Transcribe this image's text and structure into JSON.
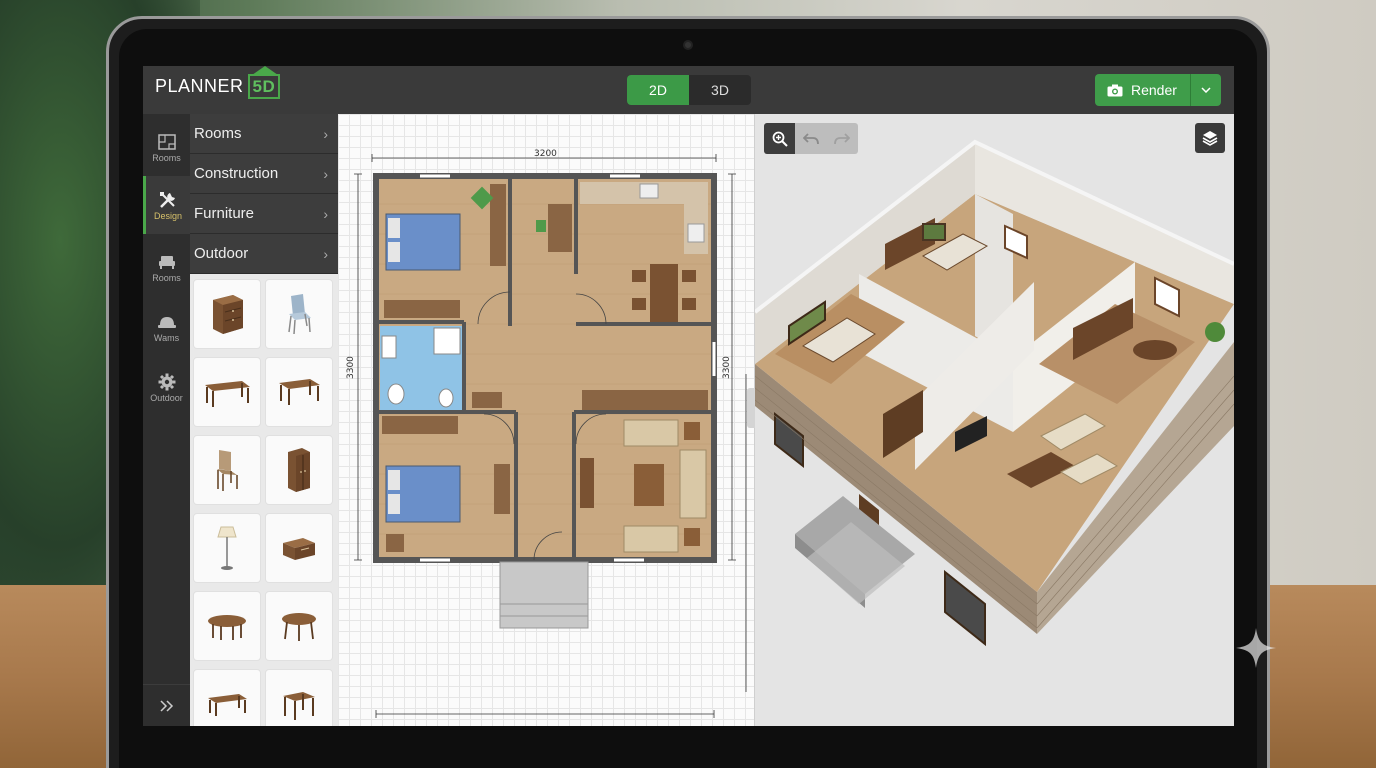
{
  "app": {
    "logo_text": "PLANNER",
    "logo_badge": "5D"
  },
  "header": {
    "mode_2d": "2D",
    "mode_3d": "3D",
    "active_mode": "2D",
    "render_label": "Render"
  },
  "rail": {
    "items": [
      {
        "label": "Rooms",
        "icon": "floorplan-icon"
      },
      {
        "label": "Design",
        "icon": "tools-icon",
        "active": true
      },
      {
        "label": "Rooms",
        "icon": "sofa-icon"
      },
      {
        "label": "Wams",
        "icon": "cap-icon"
      },
      {
        "label": "Outdoor",
        "icon": "gear-icon"
      }
    ]
  },
  "categories": [
    {
      "label": "Rooms"
    },
    {
      "label": "Construction"
    },
    {
      "label": "Furniture"
    },
    {
      "label": "Outdoor"
    }
  ],
  "catalog": [
    "nightstand-icon",
    "chair-icon",
    "coffee-table-icon",
    "bench-table-icon",
    "dining-chair-icon",
    "wardrobe-icon",
    "floor-lamp-icon",
    "chest-icon",
    "oval-table-icon",
    "round-table-icon",
    "low-table-icon",
    "square-table-icon"
  ],
  "plan": {
    "width_label": "3200",
    "left_height_label": "3300",
    "right_height_label": "3300"
  },
  "colors": {
    "accent": "#3f9d4a",
    "topbar": "#3a3a3a",
    "floor": "#c9a982",
    "bathroom": "#8fc3e6"
  }
}
